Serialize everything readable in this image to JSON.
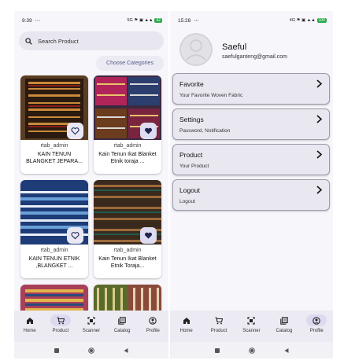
{
  "left": {
    "status": {
      "time": "9:39",
      "dots": "⋯",
      "icons": "5G ⚑ ▣ ▲▲",
      "battery": "92"
    },
    "search": {
      "placeholder": "Search Product"
    },
    "choose_categories": "Choose Categories",
    "products": [
      {
        "seller": "rtab_admin",
        "name": "KAIN TENUN BLANGKET JEPARA...",
        "favorite": false
      },
      {
        "seller": "rtab_admin",
        "name": "Kain Tenun Ikat Blanket Etnik toraja ...",
        "favorite": true
      },
      {
        "seller": "rtab_admin",
        "name": "KAIN TENUN ETNIK ,BLANGKET ...",
        "favorite": false
      },
      {
        "seller": "rtab_admin",
        "name": "Kain Tenun Ikat Blanket Etnik Toraja...",
        "favorite": true
      }
    ],
    "nav": [
      {
        "label": "Home",
        "icon": "home-icon"
      },
      {
        "label": "Product",
        "icon": "cart-icon"
      },
      {
        "label": "Scanner",
        "icon": "scanner-icon"
      },
      {
        "label": "Catalog",
        "icon": "catalog-icon"
      },
      {
        "label": "Profile",
        "icon": "profile-icon"
      }
    ],
    "active_nav": "Product"
  },
  "right": {
    "status": {
      "time": "15:28",
      "dots": "⋯",
      "icons": "4G ⚑ ▣ ▲▲",
      "battery": "100"
    },
    "profile": {
      "name": "Saeful",
      "email": "saefulganteng@gmail.com"
    },
    "menu": [
      {
        "title": "Favorite",
        "subtitle": "Your Favorite Woven Fabric"
      },
      {
        "title": "Settings",
        "subtitle": "Password, Notification"
      },
      {
        "title": "Product",
        "subtitle": "Your Product"
      },
      {
        "title": "Logout",
        "subtitle": "Logout"
      }
    ],
    "nav": [
      {
        "label": "Home",
        "icon": "home-icon"
      },
      {
        "label": "Product",
        "icon": "cart-icon"
      },
      {
        "label": "Scanner",
        "icon": "scanner-icon"
      },
      {
        "label": "Catalog",
        "icon": "catalog-icon"
      },
      {
        "label": "Profile",
        "icon": "profile-icon"
      }
    ],
    "active_nav": "Profile"
  },
  "colors": {
    "accent": "#dcdaf0",
    "background": "#f7f6fb",
    "card_border": "#9d9caa"
  }
}
